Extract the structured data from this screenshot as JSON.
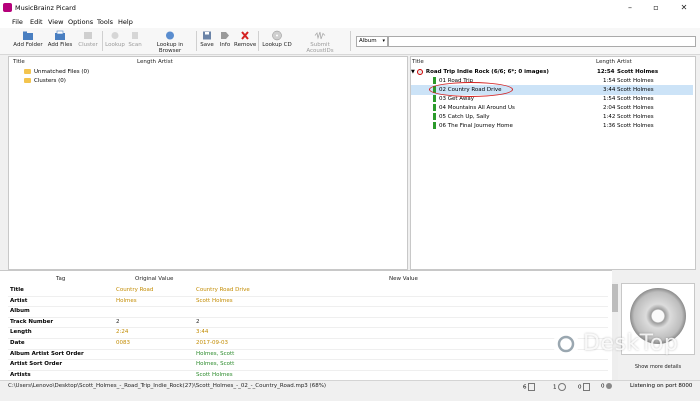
{
  "window": {
    "title": "MusicBrainz Picard",
    "minimize": "–",
    "maximize": "▫",
    "close": "✕"
  },
  "menu": [
    "File",
    "Edit",
    "View",
    "Options",
    "Tools",
    "Help"
  ],
  "toolbar": {
    "add_folder": "Add Folder",
    "add_files": "Add Files",
    "cluster": "Cluster",
    "lookup": "Lookup",
    "scan": "Scan",
    "lookup_in_browser": "Lookup in Browser",
    "save": "Save",
    "info": "Info",
    "remove": "Remove",
    "lookup_cd": "Lookup CD",
    "submit_acoustid": "Submit AcoustIDs",
    "search_type": "Album",
    "search_value": ""
  },
  "left_pane": {
    "columns": [
      "Title",
      "Length",
      "Artist"
    ],
    "items": [
      "Unmatched Files (0)",
      "Clusters (0)"
    ]
  },
  "right_pane": {
    "columns": [
      "Title",
      "Length",
      "Artist"
    ],
    "album": {
      "title": "Road Trip Indie Rock (6/6; 6*; 0 images)",
      "length": "12:54",
      "artist": "Scott Holmes"
    },
    "tracks": [
      {
        "title": "01 Road Trip",
        "length": "1:54",
        "artist": "Scott Holmes"
      },
      {
        "title": "02 Country Road Drive",
        "length": "3:44",
        "artist": "Scott Holmes"
      },
      {
        "title": "03 Get Away",
        "length": "1:54",
        "artist": "Scott Holmes"
      },
      {
        "title": "04 Mountains All Around Us",
        "length": "2:04",
        "artist": "Scott Holmes"
      },
      {
        "title": "05 Catch Up, Sally",
        "length": "1:42",
        "artist": "Scott Holmes"
      },
      {
        "title": "06 The Final Journey Home",
        "length": "1:36",
        "artist": "Scott Holmes"
      }
    ]
  },
  "metadata": {
    "col_tag": "Tag",
    "col_original": "Original Value",
    "col_new": "New Value",
    "rows": [
      {
        "tag": "Title",
        "original": "Country Road",
        "new": "Country Road Drive"
      },
      {
        "tag": "Artist",
        "original": "Holmes",
        "new": "Scott Holmes"
      },
      {
        "tag": "Album",
        "original": "",
        "new": ""
      },
      {
        "tag": "Track Number",
        "original": "2",
        "new": "2"
      },
      {
        "tag": "Length",
        "original": "2:24",
        "new": "3:44"
      },
      {
        "tag": "Date",
        "original": "0083",
        "new": "2017-09-03"
      },
      {
        "tag": "Album Artist Sort Order",
        "original": "",
        "new": "Holmes, Scott"
      },
      {
        "tag": "Artist Sort Order",
        "original": "",
        "new": "Holmes, Scott"
      },
      {
        "tag": "Artists",
        "original": "",
        "new": "Scott Holmes"
      }
    ],
    "show_more": "Show more details"
  },
  "status": {
    "path": "C:\\Users\\Lenovo\\Desktop\\Scott_Holmes_-_Road_Trip_Indie_Rock(27)\\Scott_Holmes_-_02_-_Country_Road.mp3 (68%)",
    "count_files": "6",
    "count_a": "1",
    "count_b": "0",
    "count_c": "0",
    "listening": "Listening on port 8000"
  },
  "watermark": "DeskTop",
  "colors": {
    "annotation": "#d32020",
    "selection": "#cce3f7",
    "changed_original": "#c28b00",
    "changed_new": "#2a8a2a"
  }
}
